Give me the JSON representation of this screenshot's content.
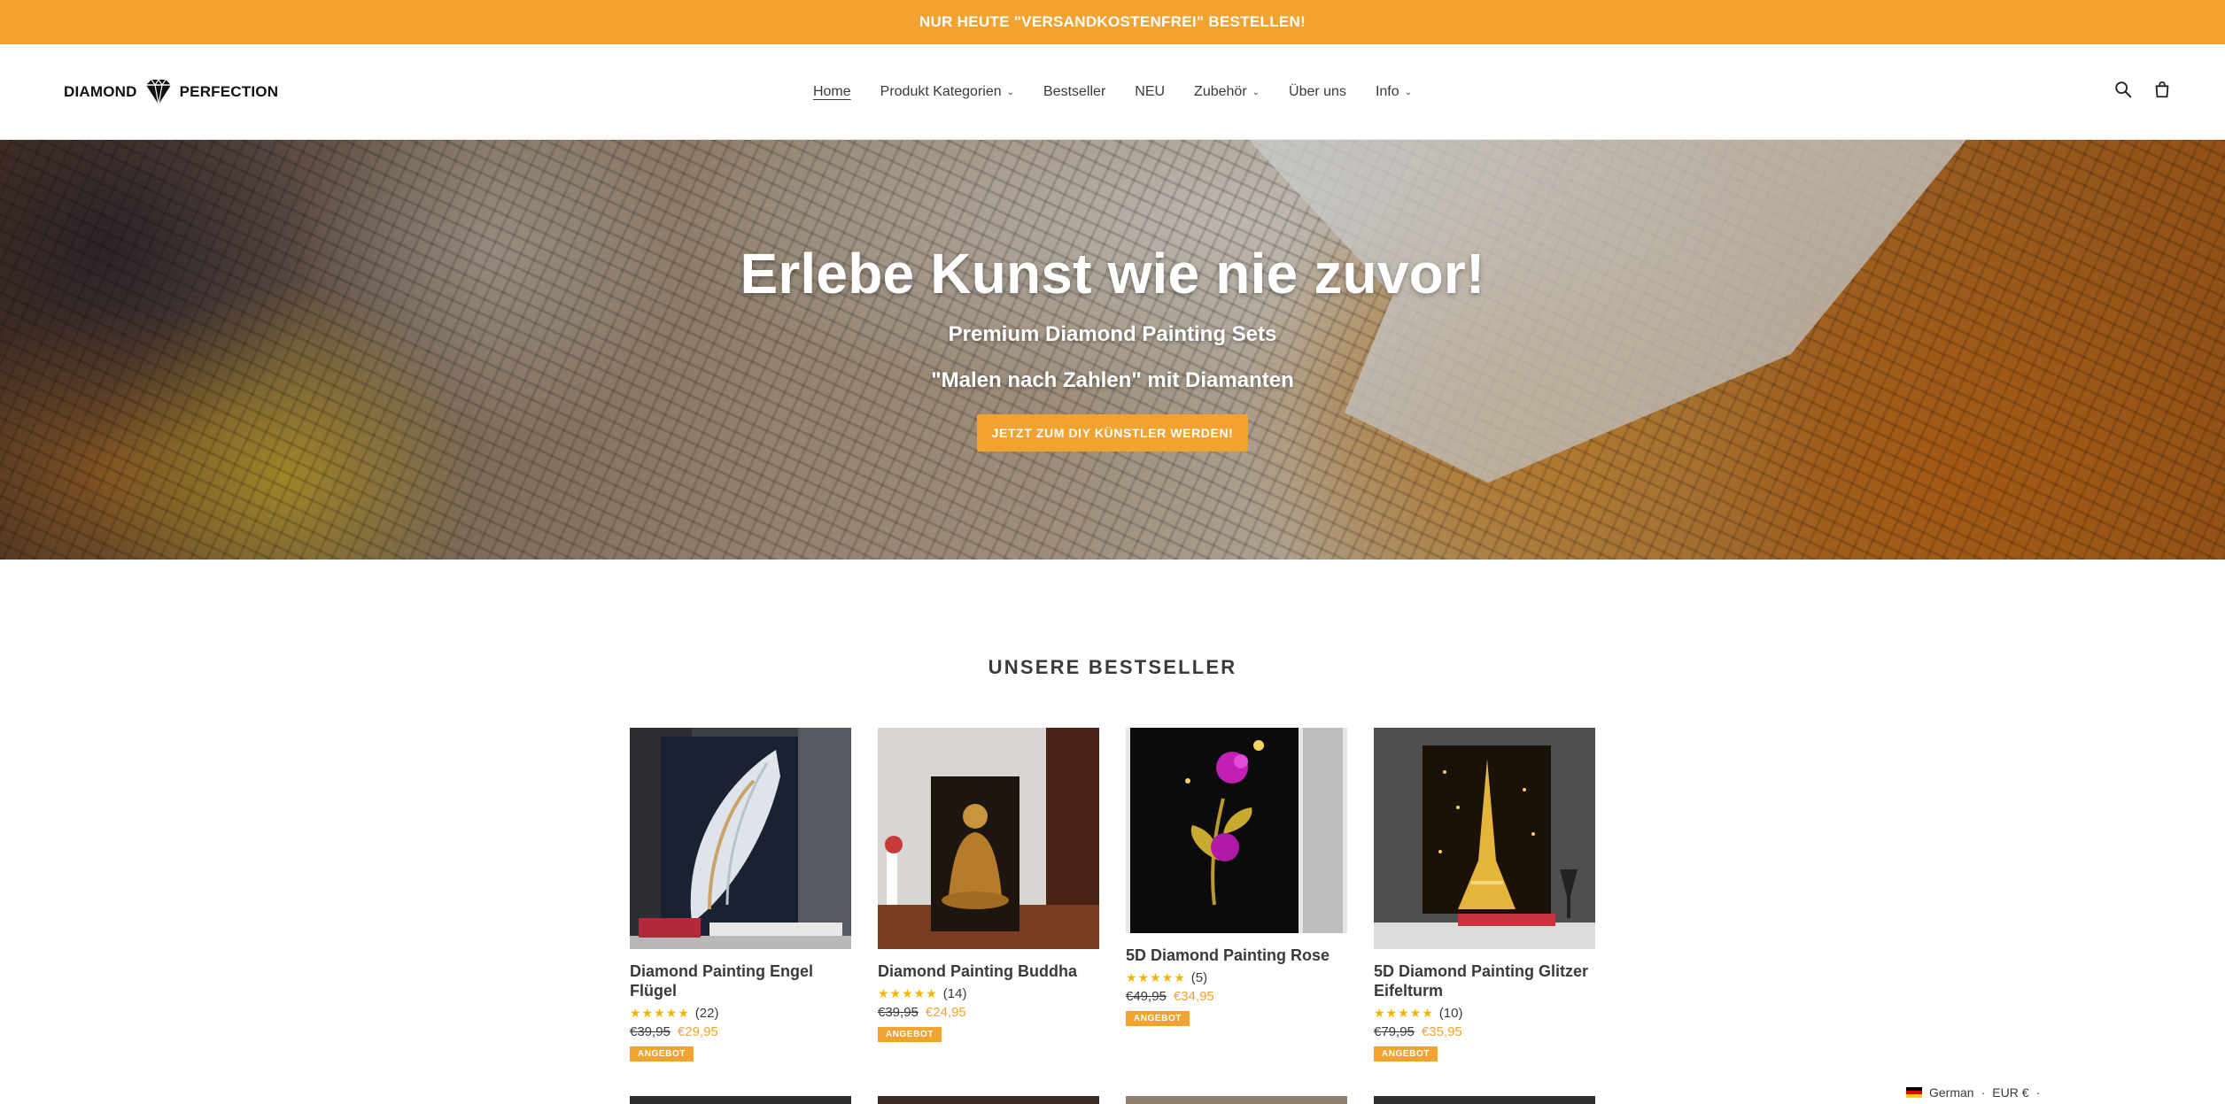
{
  "announcement": "NUR HEUTE \"VERSANDKOSTENFREI\" BESTELLEN!",
  "header": {
    "logo_left": "DIAMOND",
    "logo_right": "PERFECTION",
    "nav": [
      {
        "label": "Home"
      },
      {
        "label": "Produkt Kategorien"
      },
      {
        "label": "Bestseller"
      },
      {
        "label": "NEU"
      },
      {
        "label": "Zubehör"
      },
      {
        "label": "Über uns"
      },
      {
        "label": "Info"
      }
    ]
  },
  "hero": {
    "title": "Erlebe Kunst wie nie zuvor!",
    "subtitle1": "Premium Diamond Painting Sets",
    "subtitle2": "\"Malen nach Zahlen\" mit Diamanten",
    "button": "JETZT ZUM DIY KÜNSTLER WERDEN!"
  },
  "bestsellers": {
    "title": "UNSERE BESTSELLER",
    "products": [
      {
        "title": "Diamond Painting Engel Flügel",
        "stars": "★★★★★",
        "reviews": "(22)",
        "old_price": "€39,95",
        "new_price": "€29,95",
        "badge": "ANGEBOT"
      },
      {
        "title": "Diamond Painting Buddha",
        "stars": "★★★★★",
        "reviews": "(14)",
        "old_price": "€39,95",
        "new_price": "€24,95",
        "badge": "ANGEBOT"
      },
      {
        "title": "5D Diamond Painting Rose",
        "stars": "★★★★★",
        "reviews": "(5)",
        "old_price": "€49,95",
        "new_price": "€34,95",
        "badge": "ANGEBOT"
      },
      {
        "title": "5D Diamond Painting Glitzer Eifelturm",
        "stars": "★★★★★",
        "reviews": "(10)",
        "old_price": "€79,95",
        "new_price": "€35,95",
        "badge": "ANGEBOT"
      }
    ]
  },
  "locale": {
    "language": "German",
    "currency": "EUR €"
  },
  "colors": {
    "accent": "#f2a22e",
    "text": "#3a3a3a",
    "stars": "#f2b600"
  }
}
